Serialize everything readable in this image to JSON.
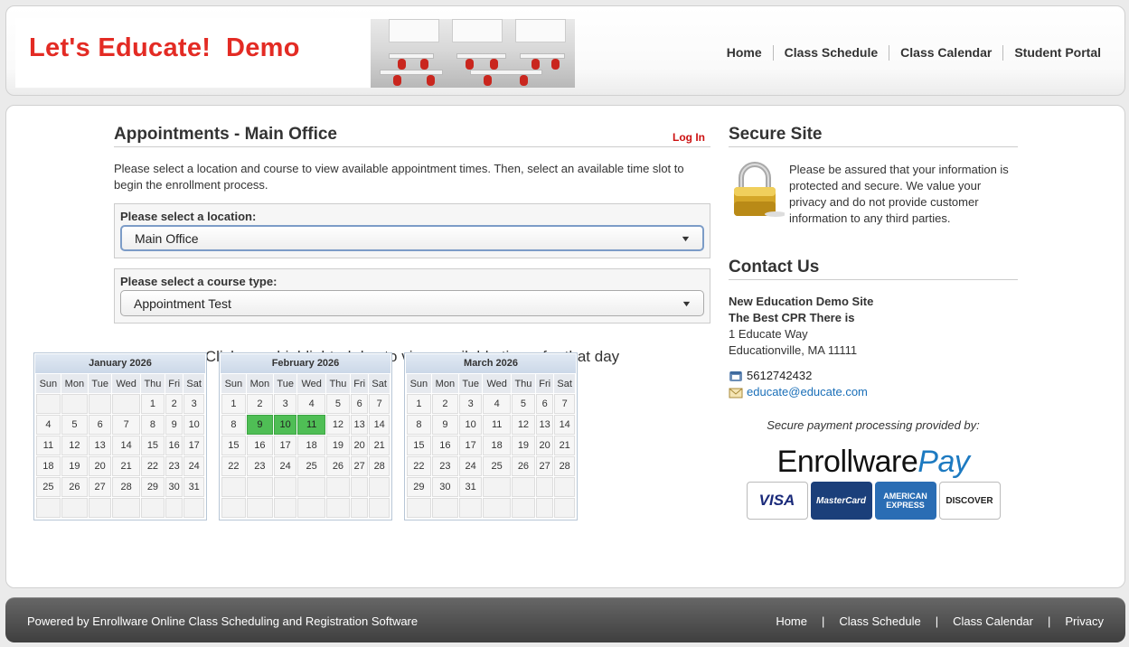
{
  "header": {
    "logo_text": "Let's Educate!  Demo",
    "nav": [
      "Home",
      "Class Schedule",
      "Class Calendar",
      "Student Portal"
    ]
  },
  "main": {
    "title": "Appointments - Main Office",
    "login_label": "Log In",
    "intro": "Please select a location and course to view available appointment times. Then, select an available time slot to begin the enrollment process.",
    "location_label": "Please select a location:",
    "location_value": "Main Office",
    "course_label": "Please select a course type:",
    "course_value": "Appointment Test",
    "calendar_title": "Click on a highlighted day to view available times for that day"
  },
  "calendars": [
    {
      "month": "January 2026",
      "days": [
        "Sun",
        "Mon",
        "Tue",
        "Wed",
        "Thu",
        "Fri",
        "Sat"
      ],
      "weeks": [
        [
          "",
          "",
          "",
          "",
          "1",
          "2",
          "3"
        ],
        [
          "4",
          "5",
          "6",
          "7",
          "8",
          "9",
          "10"
        ],
        [
          "11",
          "12",
          "13",
          "14",
          "15",
          "16",
          "17"
        ],
        [
          "18",
          "19",
          "20",
          "21",
          "22",
          "23",
          "24"
        ],
        [
          "25",
          "26",
          "27",
          "28",
          "29",
          "30",
          "31"
        ],
        [
          "",
          "",
          "",
          "",
          "",
          "",
          ""
        ]
      ],
      "available": []
    },
    {
      "month": "February 2026",
      "days": [
        "Sun",
        "Mon",
        "Tue",
        "Wed",
        "Thu",
        "Fri",
        "Sat"
      ],
      "weeks": [
        [
          "1",
          "2",
          "3",
          "4",
          "5",
          "6",
          "7"
        ],
        [
          "8",
          "9",
          "10",
          "11",
          "12",
          "13",
          "14"
        ],
        [
          "15",
          "16",
          "17",
          "18",
          "19",
          "20",
          "21"
        ],
        [
          "22",
          "23",
          "24",
          "25",
          "26",
          "27",
          "28"
        ],
        [
          "",
          "",
          "",
          "",
          "",
          "",
          ""
        ],
        [
          "",
          "",
          "",
          "",
          "",
          "",
          ""
        ]
      ],
      "available": [
        "9",
        "10",
        "11"
      ]
    },
    {
      "month": "March 2026",
      "days": [
        "Sun",
        "Mon",
        "Tue",
        "Wed",
        "Thu",
        "Fri",
        "Sat"
      ],
      "weeks": [
        [
          "1",
          "2",
          "3",
          "4",
          "5",
          "6",
          "7"
        ],
        [
          "8",
          "9",
          "10",
          "11",
          "12",
          "13",
          "14"
        ],
        [
          "15",
          "16",
          "17",
          "18",
          "19",
          "20",
          "21"
        ],
        [
          "22",
          "23",
          "24",
          "25",
          "26",
          "27",
          "28"
        ],
        [
          "29",
          "30",
          "31",
          "",
          "",
          "",
          ""
        ],
        [
          "",
          "",
          "",
          "",
          "",
          "",
          ""
        ]
      ],
      "available": []
    }
  ],
  "sidebar": {
    "secure_title": "Secure Site",
    "secure_text": "Please be assured that your information is protected and secure. We value your privacy and do not provide customer information to any third parties.",
    "contact_title": "Contact Us",
    "org_name": "New Education Demo Site",
    "tagline": "The Best CPR There is",
    "address1": "1 Educate Way",
    "address2": "Educationville, MA 11111",
    "phone": "5612742432",
    "email": "educate@educate.com",
    "payment_caption": "Secure payment processing provided by:",
    "payment_brand_a": "Enrollware",
    "payment_brand_b": "Pay",
    "cards": [
      "VISA",
      "MasterCard",
      "AMERICAN EXPRESS",
      "DISCOVER"
    ]
  },
  "footer": {
    "powered": "Powered by Enrollware Online Class Scheduling and Registration Software",
    "links": [
      "Home",
      "Class Schedule",
      "Class Calendar",
      "Privacy"
    ],
    "separator": "|"
  },
  "colors": {
    "logo_red": "#e32b24",
    "available_green": "#4fbe55",
    "link_blue": "#1a6fb8",
    "login_red": "#cc1111"
  }
}
